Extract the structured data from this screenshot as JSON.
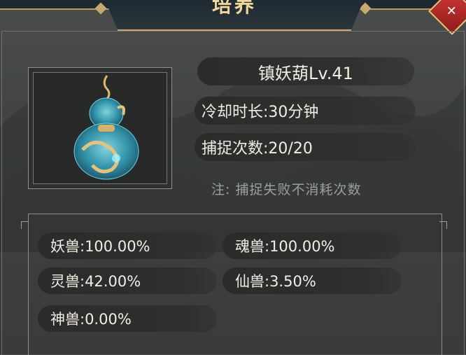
{
  "header": {
    "title": "培养",
    "close_icon": "close-icon"
  },
  "item": {
    "name": "镇妖葫Lv.41",
    "cooldown": "冷却时长:30分钟",
    "captures": "捕捉次数:20/20",
    "note": "注: 捕捉失败不消耗次数",
    "image_icon": "gourd-icon"
  },
  "rates": [
    {
      "label": "妖兽:100.00%"
    },
    {
      "label": "魂兽:100.00%"
    },
    {
      "label": "灵兽:42.00%"
    },
    {
      "label": "仙兽:3.50%"
    },
    {
      "label": "神兽:0.00%"
    }
  ],
  "colors": {
    "accent_gold": "#c9a96a",
    "text": "#f2ede0",
    "close_red": "#d23a3a"
  }
}
